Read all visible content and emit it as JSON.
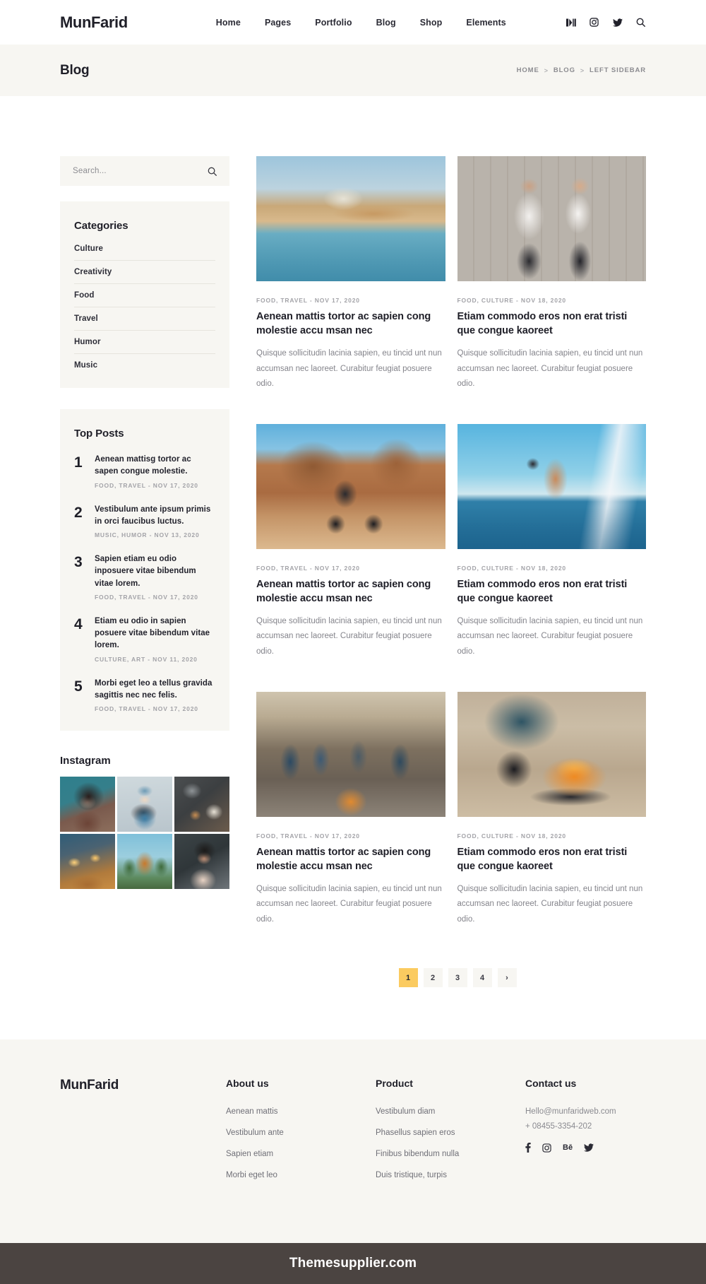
{
  "header": {
    "brand": "MunFarid",
    "nav": [
      {
        "label": "Home"
      },
      {
        "label": "Pages"
      },
      {
        "label": "Portfolio"
      },
      {
        "label": "Blog"
      },
      {
        "label": "Shop"
      },
      {
        "label": "Elements"
      }
    ],
    "icons": [
      {
        "name": "medium-icon"
      },
      {
        "name": "instagram-icon"
      },
      {
        "name": "twitter-icon"
      },
      {
        "name": "search-icon"
      }
    ]
  },
  "page_bar": {
    "title": "Blog",
    "breadcrumb": [
      "HOME",
      "BLOG",
      "LEFT SIDEBAR"
    ],
    "separator": ">"
  },
  "sidebar": {
    "search": {
      "placeholder": "Search...",
      "value": ""
    },
    "categories": {
      "title": "Categories",
      "items": [
        {
          "label": "Culture"
        },
        {
          "label": "Creativity"
        },
        {
          "label": "Food"
        },
        {
          "label": "Travel"
        },
        {
          "label": "Humor"
        },
        {
          "label": "Music"
        }
      ]
    },
    "top_posts": {
      "title": "Top Posts",
      "items": [
        {
          "num": "1",
          "title": "Aenean mattisg tortor ac sapen congue molestie.",
          "meta": "FOOD, TRAVEL - NOV 17, 2020"
        },
        {
          "num": "2",
          "title": "Vestibulum ante ipsum primis in orci faucibus luctus.",
          "meta": "MUSIC, HUMOR - NOV 13, 2020"
        },
        {
          "num": "3",
          "title": "Sapien  etiam eu odio inposuere vitae bibendum vitae lorem.",
          "meta": "FOOD, TRAVEL - NOV 17, 2020"
        },
        {
          "num": "4",
          "title": "Etiam eu odio in sapien posuere vitae bibendum vitae lorem.",
          "meta": "CULTURE, ART - NOV 11, 2020"
        },
        {
          "num": "5",
          "title": "Morbi eget leo a tellus gravida sagittis nec nec felis.",
          "meta": "FOOD, TRAVEL - NOV 17, 2020"
        }
      ]
    },
    "instagram": {
      "title": "Instagram",
      "cells": [
        {
          "name": "instagram-photo-1"
        },
        {
          "name": "instagram-photo-2"
        },
        {
          "name": "instagram-photo-3"
        },
        {
          "name": "instagram-photo-4"
        },
        {
          "name": "instagram-photo-5"
        },
        {
          "name": "instagram-photo-6"
        }
      ]
    }
  },
  "posts": [
    {
      "image": "venice-canal-basilica",
      "meta": "FOOD, TRAVEL - NOV 17, 2020",
      "title": "Aenean mattis tortor ac sapien cong molestie accu msan nec",
      "excerpt": "Quisque sollicitudin lacinia sapien, eu tincid unt nun accumsan nec laoreet. Curabitur feugiat posuere odio."
    },
    {
      "image": "couple-wooden-wall",
      "meta": "FOOD, CULTURE - NOV 18, 2020",
      "title": "Etiam commodo eros non erat tristi que congue kaoreet",
      "excerpt": "Quisque sollicitudin lacinia sapien, eu tincid unt nun accumsan nec laoreet. Curabitur feugiat posuere odio."
    },
    {
      "image": "mountain-biker-desert",
      "meta": "FOOD, TRAVEL - NOV 17, 2020",
      "title": "Aenean mattis tortor ac sapien cong molestie accu msan nec",
      "excerpt": "Quisque sollicitudin lacinia sapien, eu tincid unt nun accumsan nec laoreet. Curabitur feugiat posuere odio."
    },
    {
      "image": "man-on-sailboat",
      "meta": "FOOD, CULTURE - NOV 18, 2020",
      "title": "Etiam commodo eros non erat tristi que congue kaoreet",
      "excerpt": "Quisque sollicitudin lacinia sapien, eu tincid unt nun accumsan nec laoreet. Curabitur feugiat posuere odio."
    },
    {
      "image": "friends-campfire",
      "meta": "FOOD, TRAVEL - NOV 17, 2020",
      "title": "Aenean mattis tortor ac sapien cong molestie accu msan nec",
      "excerpt": "Quisque sollicitudin lacinia sapien, eu tincid unt nun accumsan nec laoreet. Curabitur feugiat posuere odio."
    },
    {
      "image": "beach-grill-fire",
      "meta": "FOOD, CULTURE - NOV 18, 2020",
      "title": "Etiam commodo eros non erat tristi que congue kaoreet",
      "excerpt": "Quisque sollicitudin lacinia sapien, eu tincid unt nun accumsan nec laoreet. Curabitur feugiat posuere odio."
    }
  ],
  "pagination": {
    "pages": [
      "1",
      "2",
      "3",
      "4"
    ],
    "next_label": "›",
    "active": "1",
    "active_color": "#fbcb60"
  },
  "footer": {
    "brand": "MunFarid",
    "columns": [
      {
        "title": "About us",
        "links": [
          "Aenean mattis",
          "Vestibulum ante",
          "Sapien etiam",
          "Morbi eget leo"
        ]
      },
      {
        "title": "Product",
        "links": [
          "Vestibulum diam",
          "Phasellus sapien eros",
          "Finibus bibendum nulla",
          "Duis tristique, turpis"
        ]
      }
    ],
    "contact": {
      "title": "Contact us",
      "email": "Hello@munfaridweb.com",
      "phone": "+ 08455-3354-202",
      "socials": [
        {
          "name": "facebook-icon",
          "glyph": "f"
        },
        {
          "name": "instagram-icon",
          "glyph": ""
        },
        {
          "name": "behance-icon",
          "glyph": "Bē"
        },
        {
          "name": "twitter-icon",
          "glyph": ""
        }
      ]
    }
  },
  "bottom_bar": {
    "text": "Themesupplier.com"
  }
}
